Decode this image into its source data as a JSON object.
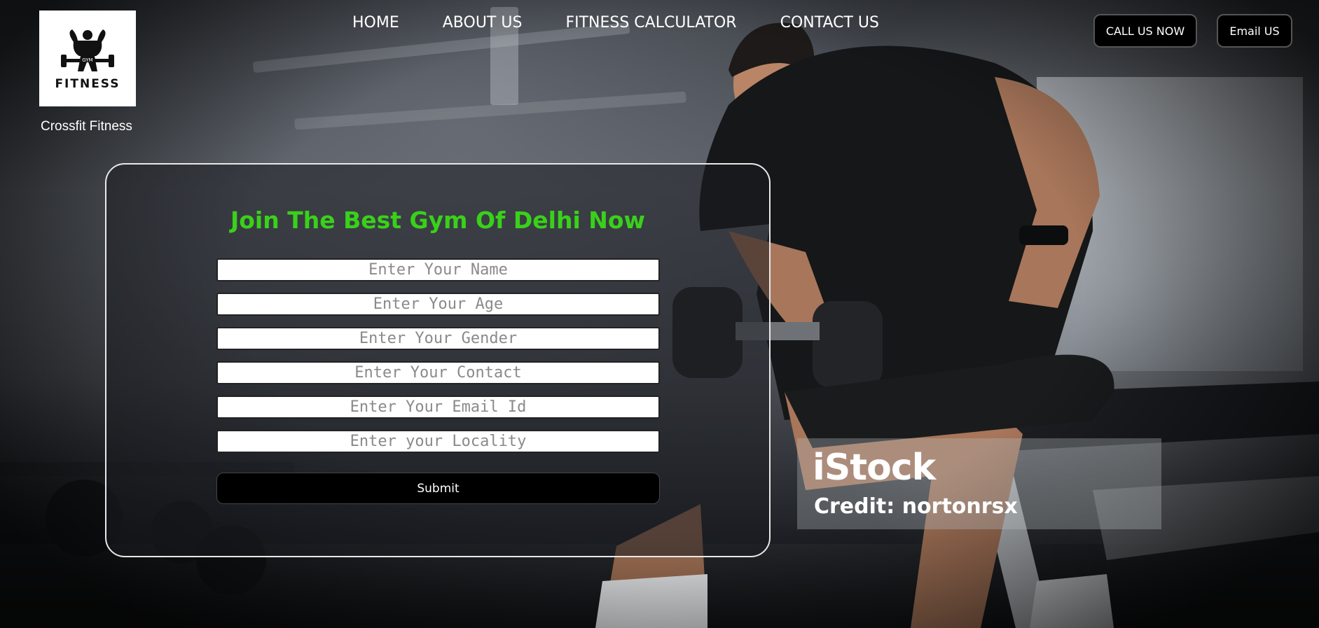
{
  "logo": {
    "word": "FITNESS",
    "badge": "GYM",
    "caption": "Crossfit Fitness"
  },
  "nav": {
    "items": [
      "HOME",
      "ABOUT US",
      "FITNESS CALCULATOR",
      "CONTACT US"
    ]
  },
  "actions": {
    "call": "CALL US NOW",
    "email": "Email US"
  },
  "form": {
    "title": "Join The Best Gym Of Delhi Now",
    "fields": [
      {
        "placeholder": "Enter Your Name",
        "value": ""
      },
      {
        "placeholder": "Enter Your Age",
        "value": ""
      },
      {
        "placeholder": "Enter Your Gender",
        "value": ""
      },
      {
        "placeholder": "Enter Your Contact",
        "value": ""
      },
      {
        "placeholder": "Enter Your Email Id",
        "value": ""
      },
      {
        "placeholder": "Enter your Locality",
        "value": ""
      }
    ],
    "submit": "Submit"
  },
  "watermark": {
    "brand": "iStock",
    "credit": "Credit: nortonrsx"
  },
  "colors": {
    "accent_green": "#39d11a",
    "button_bg": "#000000",
    "text_light": "#ffffff"
  }
}
